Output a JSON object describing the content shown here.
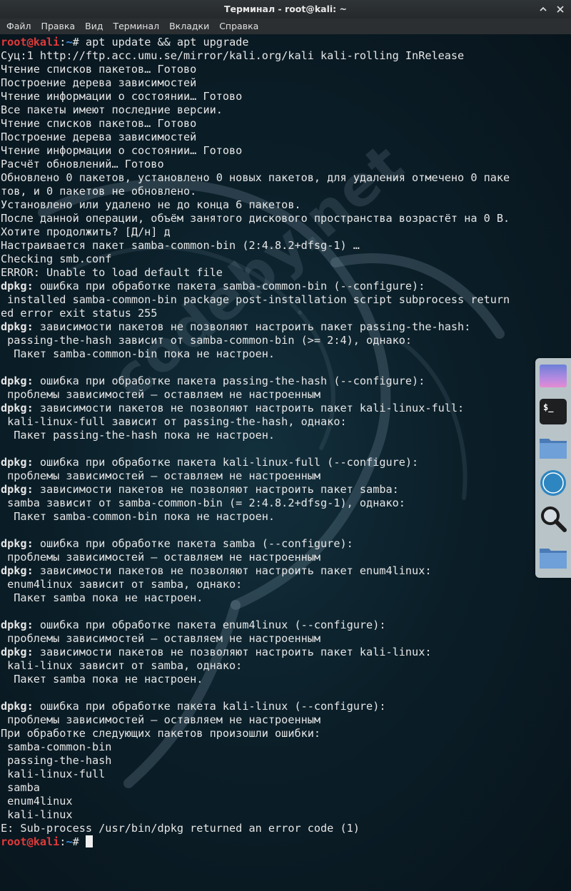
{
  "window": {
    "title": "Терминал - root@kali: ~"
  },
  "menu": [
    "Файл",
    "Правка",
    "Вид",
    "Терминал",
    "Вкладки",
    "Справка"
  ],
  "prompt": {
    "user": "root@kali",
    "path": "~",
    "symbol": "#"
  },
  "command": "apt update && apt upgrade",
  "output": [
    {
      "text": "Суц:1 http://ftp.acc.umu.se/mirror/kali.org/kali kali-rolling InRelease"
    },
    {
      "text": "Чтение списков пакетов… Готово"
    },
    {
      "text": "Построение дерева зависимостей"
    },
    {
      "text": "Чтение информации о состоянии… Готово"
    },
    {
      "text": "Все пакеты имеют последние версии."
    },
    {
      "text": "Чтение списков пакетов… Готово"
    },
    {
      "text": "Построение дерева зависимостей"
    },
    {
      "text": "Чтение информации о состоянии… Готово"
    },
    {
      "text": "Расчёт обновлений… Готово"
    },
    {
      "text": "Обновлено 0 пакетов, установлено 0 новых пакетов, для удаления отмечено 0 паке"
    },
    {
      "text": "тов, и 0 пакетов не обновлено."
    },
    {
      "text": "Установлено или удалено не до конца 6 пакетов."
    },
    {
      "text": "После данной операции, объём занятого дискового пространства возрастёт на 0 B."
    },
    {
      "text": "Хотите продолжить? [Д/н] д"
    },
    {
      "text": "Настраивается пакет samba-common-bin (2:4.8.2+dfsg-1) …"
    },
    {
      "text": "Checking smb.conf"
    },
    {
      "text": "ERROR: Unable to load default file"
    },
    {
      "prefix": "dpkg:",
      "text": " ошибка при обработке пакета samba-common-bin (--configure):"
    },
    {
      "text": " installed samba-common-bin package post-installation script subprocess return"
    },
    {
      "text": "ed error exit status 255"
    },
    {
      "prefix": "dpkg:",
      "text": " зависимости пакетов не позволяют настроить пакет passing-the-hash:"
    },
    {
      "text": " passing-the-hash зависит от samba-common-bin (>= 2:4), однако:"
    },
    {
      "text": "  Пакет samba-common-bin пока не настроен."
    },
    {
      "text": ""
    },
    {
      "prefix": "dpkg:",
      "text": " ошибка при обработке пакета passing-the-hash (--configure):"
    },
    {
      "text": " проблемы зависимостей — оставляем не настроенным"
    },
    {
      "prefix": "dpkg:",
      "text": " зависимости пакетов не позволяют настроить пакет kali-linux-full:"
    },
    {
      "text": " kali-linux-full зависит от passing-the-hash, однако:"
    },
    {
      "text": "  Пакет passing-the-hash пока не настроен."
    },
    {
      "text": ""
    },
    {
      "prefix": "dpkg:",
      "text": " ошибка при обработке пакета kali-linux-full (--configure):"
    },
    {
      "text": " проблемы зависимостей — оставляем не настроенным"
    },
    {
      "prefix": "dpkg:",
      "text": " зависимости пакетов не позволяют настроить пакет samba:"
    },
    {
      "text": " samba зависит от samba-common-bin (= 2:4.8.2+dfsg-1), однако:"
    },
    {
      "text": "  Пакет samba-common-bin пока не настроен."
    },
    {
      "text": ""
    },
    {
      "prefix": "dpkg:",
      "text": " ошибка при обработке пакета samba (--configure):"
    },
    {
      "text": " проблемы зависимостей — оставляем не настроенным"
    },
    {
      "prefix": "dpkg:",
      "text": " зависимости пакетов не позволяют настроить пакет enum4linux:"
    },
    {
      "text": " enum4linux зависит от samba, однако:"
    },
    {
      "text": "  Пакет samba пока не настроен."
    },
    {
      "text": ""
    },
    {
      "prefix": "dpkg:",
      "text": " ошибка при обработке пакета enum4linux (--configure):"
    },
    {
      "text": " проблемы зависимостей — оставляем не настроенным"
    },
    {
      "prefix": "dpkg:",
      "text": " зависимости пакетов не позволяют настроить пакет kali-linux:"
    },
    {
      "text": " kali-linux зависит от samba, однако:"
    },
    {
      "text": "  Пакет samba пока не настроен."
    },
    {
      "text": ""
    },
    {
      "prefix": "dpkg:",
      "text": " ошибка при обработке пакета kali-linux (--configure):"
    },
    {
      "text": " проблемы зависимостей — оставляем не настроенным"
    },
    {
      "text": "При обработке следующих пакетов произошли ошибки:"
    },
    {
      "text": " samba-common-bin"
    },
    {
      "text": " passing-the-hash"
    },
    {
      "text": " kali-linux-full"
    },
    {
      "text": " samba"
    },
    {
      "text": " enum4linux"
    },
    {
      "text": " kali-linux"
    },
    {
      "text": "E: Sub-process /usr/bin/dpkg returned an error code (1)"
    }
  ],
  "watermark": "codeby.net",
  "dock": [
    {
      "name": "desktop-icon"
    },
    {
      "name": "terminal-icon"
    },
    {
      "name": "folder-icon"
    },
    {
      "name": "browser-compass-icon"
    },
    {
      "name": "search-magnifier-icon"
    },
    {
      "name": "folder-icon"
    }
  ],
  "colors": {
    "prompt_user": "#e23a3a",
    "prompt_path": "#3b8eea",
    "text": "#e6e6e6",
    "background": "#0b1f29"
  }
}
